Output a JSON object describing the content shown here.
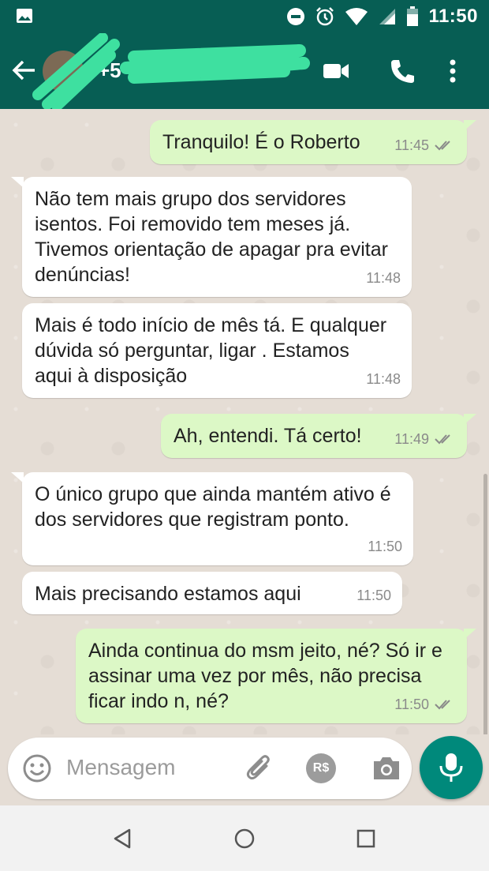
{
  "status_bar": {
    "time": "11:50",
    "icons": [
      "image-notification-icon",
      "do-not-disturb-icon",
      "alarm-icon",
      "wifi-icon",
      "signal-icon",
      "battery-icon"
    ]
  },
  "header": {
    "contact_visible_text": "+5",
    "back_icon": "back-arrow-icon",
    "actions": [
      "video-call-icon",
      "phone-call-icon",
      "more-options-icon"
    ],
    "redacted": true
  },
  "messages": [
    {
      "direction": "out",
      "text": "Tranquilo! É o Roberto",
      "time": "11:45",
      "read": true
    },
    {
      "direction": "in",
      "text": "Não tem mais grupo dos servidores isentos. Foi removido tem meses já. Tivemos orientação de apagar pra evitar denúncias!",
      "time": "11:48"
    },
    {
      "direction": "in",
      "text": "Mais é todo início de mês tá. E qualquer dúvida só perguntar, ligar . Estamos aqui à disposição",
      "time": "11:48"
    },
    {
      "direction": "out",
      "text": "Ah, entendi. Tá certo!",
      "time": "11:49",
      "read": true
    },
    {
      "direction": "in",
      "text": "O único grupo que ainda mantém ativo é dos servidores que registram ponto.",
      "time": "11:50"
    },
    {
      "direction": "in",
      "text": "Mais precisando estamos aqui",
      "time": "11:50"
    },
    {
      "direction": "out",
      "text": "Ainda continua do msm jeito, né? Só ir e assinar uma vez por mês, não precisa ficar indo n, né?",
      "time": "11:50",
      "read": true
    }
  ],
  "composer": {
    "placeholder": "Mensagem",
    "payment_label": "R$",
    "icons": [
      "emoji-icon",
      "attach-icon",
      "payment-icon",
      "camera-icon",
      "mic-icon"
    ]
  },
  "nav": [
    "back-triangle-icon",
    "home-circle-icon",
    "recents-square-icon"
  ],
  "colors": {
    "header": "#075e54",
    "outgoing_bubble": "#dcf8c6",
    "incoming_bubble": "#ffffff",
    "chat_background": "#e5ddd5",
    "mic_button": "#00897b",
    "redaction": "#3ee0a0"
  }
}
